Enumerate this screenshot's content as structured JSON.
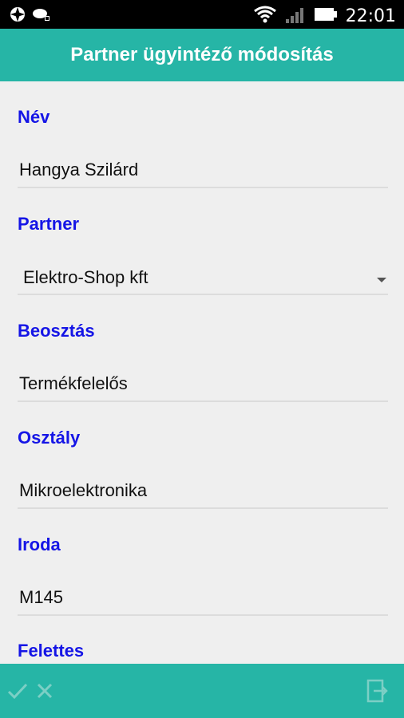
{
  "status_bar": {
    "time": "22:01"
  },
  "header": {
    "title": "Partner ügyintéző módosítás"
  },
  "form": {
    "fields": [
      {
        "label": "Név",
        "value": "Hangya Szilárd"
      },
      {
        "label": "Partner",
        "value": "Elektro-Shop kft"
      },
      {
        "label": "Beosztás",
        "value": "Termékfelelős"
      },
      {
        "label": "Osztály",
        "value": "Mikroelektronika"
      },
      {
        "label": "Iroda",
        "value": "M145"
      },
      {
        "label": "Felettes",
        "value": ""
      }
    ]
  },
  "colors": {
    "accent": "#26b5a6",
    "label": "#1515e6",
    "statusbar": "#000000"
  },
  "icons": {
    "confirm": "check-icon",
    "cancel": "close-icon",
    "exit": "exit-icon"
  }
}
